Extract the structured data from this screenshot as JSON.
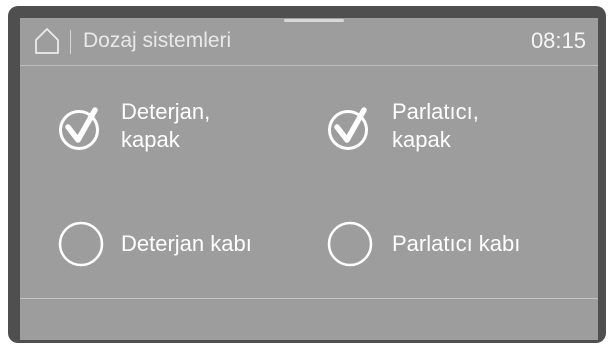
{
  "header": {
    "title": "Dozaj sistemleri",
    "time": "08:15"
  },
  "items": [
    {
      "label_line1": "Deterjan,",
      "label_line2": "kapak",
      "status": "checked"
    },
    {
      "label_line1": "Parlatıcı,",
      "label_line2": "kapak",
      "status": "checked"
    },
    {
      "label_line1": "Deterjan kabı",
      "status": "unchecked"
    },
    {
      "label_line1": "Parlatıcı kabı",
      "status": "unchecked"
    }
  ]
}
